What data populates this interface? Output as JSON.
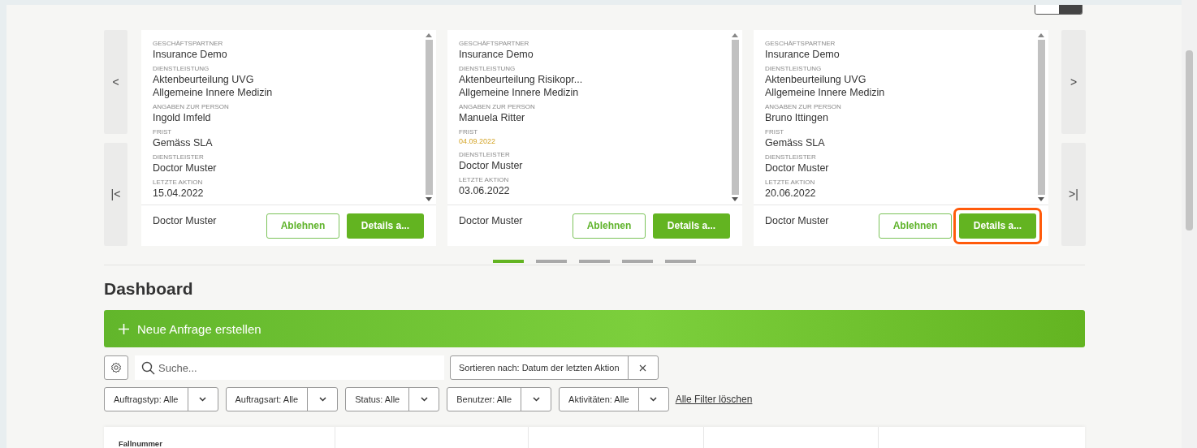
{
  "carousel": {
    "cards": [
      {
        "fields": [
          {
            "kind": "text",
            "label": "GESCHÄFTSPARTNER",
            "values": [
              "Insurance Demo"
            ]
          },
          {
            "kind": "text",
            "label": "DIENSTLEISTUNG",
            "values": [
              "Aktenbeurteilung UVG",
              "Allgemeine Innere Medizin"
            ]
          },
          {
            "kind": "text",
            "label": "ANGABEN ZUR PERSON",
            "values": [
              "Ingold Imfeld"
            ]
          },
          {
            "kind": "text",
            "label": "FRIST",
            "values": [
              "Gemäss SLA"
            ]
          },
          {
            "kind": "text",
            "label": "DIENSTLEISTER",
            "values": [
              "Doctor Muster"
            ]
          },
          {
            "kind": "text",
            "label": "LETZTE AKTION",
            "values": [
              "15.04.2022"
            ]
          }
        ],
        "footer_name": "Doctor Muster",
        "reject_label": "Ablehnen",
        "details_label": "Details a...",
        "highlighted": false
      },
      {
        "fields": [
          {
            "kind": "text",
            "label": "GESCHÄFTSPARTNER",
            "values": [
              "Insurance Demo"
            ]
          },
          {
            "kind": "text",
            "label": "DIENSTLEISTUNG",
            "values": [
              "Aktenbeurteilung Risikopr...",
              "Allgemeine Innere Medizin"
            ]
          },
          {
            "kind": "text",
            "label": "ANGABEN ZUR PERSON",
            "values": [
              "Manuela Ritter"
            ]
          },
          {
            "kind": "warning",
            "label": "FRIST",
            "values": [
              "04.09.2022"
            ]
          },
          {
            "kind": "text",
            "label": "DIENSTLEISTER",
            "values": [
              "Doctor Muster"
            ]
          },
          {
            "kind": "text",
            "label": "LETZTE AKTION",
            "values": [
              "03.06.2022"
            ]
          }
        ],
        "footer_name": "Doctor Muster",
        "reject_label": "Ablehnen",
        "details_label": "Details a...",
        "highlighted": false
      },
      {
        "fields": [
          {
            "kind": "text",
            "label": "GESCHÄFTSPARTNER",
            "values": [
              "Insurance Demo"
            ]
          },
          {
            "kind": "text",
            "label": "DIENSTLEISTUNG",
            "values": [
              "Aktenbeurteilung UVG",
              "Allgemeine Innere Medizin"
            ]
          },
          {
            "kind": "text",
            "label": "ANGABEN ZUR PERSON",
            "values": [
              "Bruno Ittingen"
            ]
          },
          {
            "kind": "text",
            "label": "FRIST",
            "values": [
              "Gemäss SLA"
            ]
          },
          {
            "kind": "text",
            "label": "DIENSTLEISTER",
            "values": [
              "Doctor Muster"
            ]
          },
          {
            "kind": "text",
            "label": "LETZTE AKTION",
            "values": [
              "20.06.2022"
            ]
          }
        ],
        "footer_name": "Doctor Muster",
        "reject_label": "Ablehnen",
        "details_label": "Details a...",
        "highlighted": true
      }
    ],
    "nav_prev": "<",
    "nav_first": "|<",
    "nav_next": ">",
    "nav_last": ">|",
    "pages": [
      {
        "selected": true
      },
      {
        "selected": false
      },
      {
        "selected": false
      },
      {
        "selected": false
      },
      {
        "selected": false
      }
    ]
  },
  "dashboard": {
    "title": "Dashboard",
    "create_button": "Neue Anfrage erstellen",
    "search": {
      "placeholder": "Suche..."
    },
    "sort": {
      "label": "Sortieren nach: Datum der letzten Aktion"
    },
    "filters": [
      "Auftragstyp: Alle",
      "Auftragsart: Alle",
      "Status: Alle",
      "Benutzer: Alle",
      "Aktivitäten: Alle"
    ],
    "clear_filters": "Alle Filter löschen",
    "table": {
      "columns": [
        "Fallnummer"
      ]
    }
  }
}
